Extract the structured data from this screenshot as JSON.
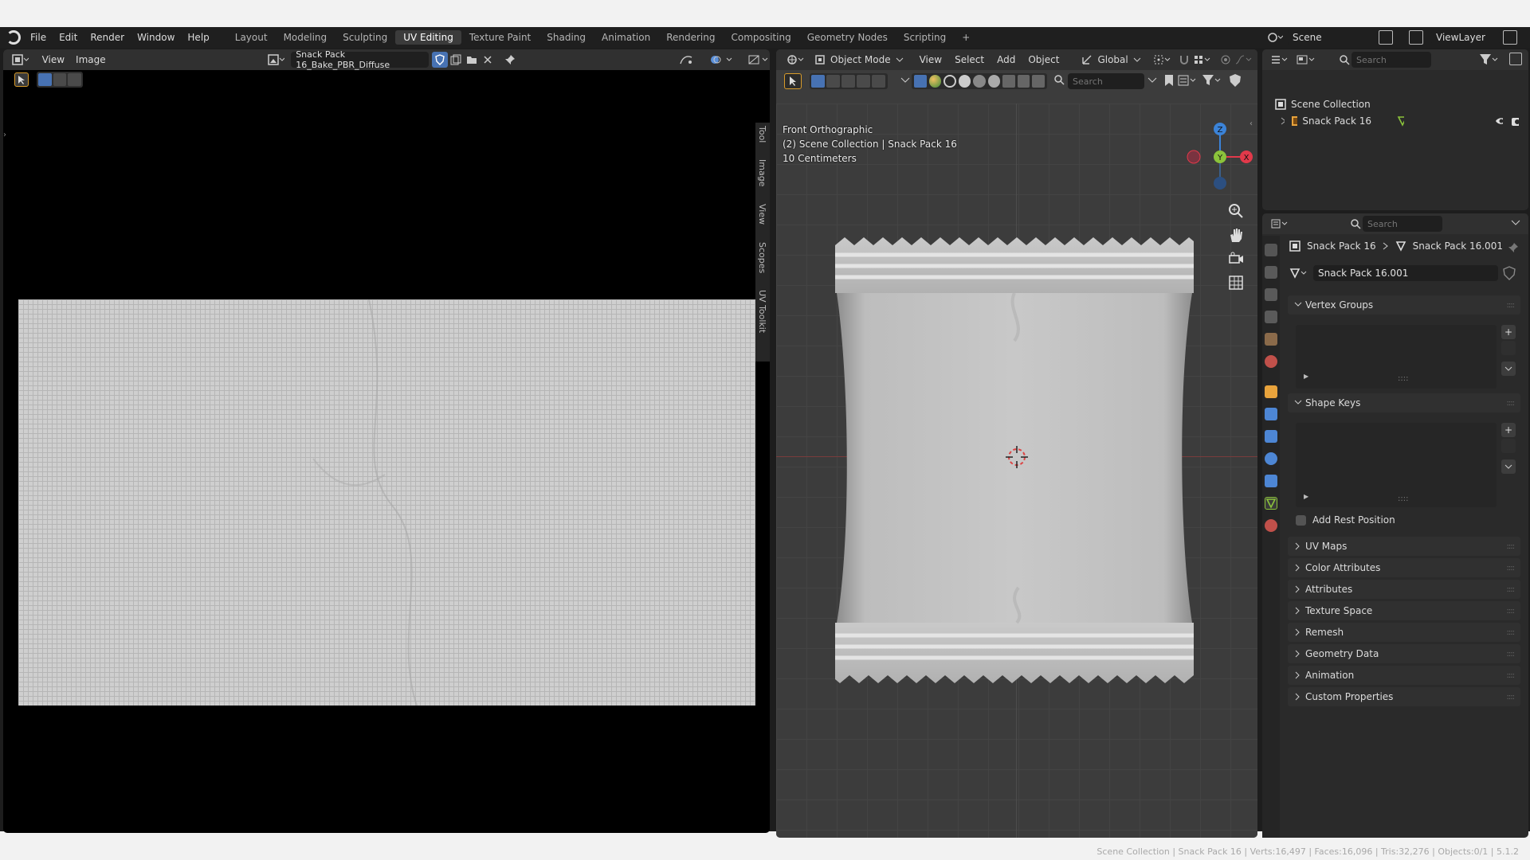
{
  "menu": [
    "File",
    "Edit",
    "Render",
    "Window",
    "Help"
  ],
  "workspaces": [
    "Layout",
    "Modeling",
    "Sculpting",
    "UV Editing",
    "Texture Paint",
    "Shading",
    "Animation",
    "Rendering",
    "Compositing",
    "Geometry Nodes",
    "Scripting"
  ],
  "active_workspace": "UV Editing",
  "add_workspace": "+",
  "scene": {
    "label": "Scene",
    "view_layer": "ViewLayer"
  },
  "uv_editor": {
    "menu": [
      "View",
      "Image"
    ],
    "image_name": "Snack Pack 16_Bake_PBR_Diffuse",
    "side_tabs": [
      "Tool",
      "Image",
      "View",
      "Scopes",
      "UV Toolkit"
    ]
  },
  "viewport": {
    "mode": "Object Mode",
    "menu": [
      "View",
      "Select",
      "Add",
      "Object"
    ],
    "orientation": "Global",
    "search_placeholder": "Search",
    "view_name": "Front Orthographic",
    "collection_info": "(2) Scene Collection | Snack Pack 16",
    "scale": "10 Centimeters",
    "gizmo": {
      "z": "Z",
      "y": "Y",
      "x": "X"
    }
  },
  "outliner": {
    "search_placeholder": "Search",
    "root": "Scene Collection",
    "items": [
      {
        "label": "Snack Pack 16"
      }
    ]
  },
  "properties": {
    "search_placeholder": "Search",
    "breadcrumb": [
      "Snack Pack 16",
      "Snack Pack 16.001"
    ],
    "datablock": "Snack Pack 16.001",
    "vertex_groups": "Vertex Groups",
    "shape_keys": "Shape Keys",
    "add_rest_position": "Add Rest Position",
    "panels": [
      "UV Maps",
      "Color Attributes",
      "Attributes",
      "Texture Space",
      "Remesh",
      "Geometry Data",
      "Animation",
      "Custom Properties"
    ]
  },
  "status_bar": "Scene Collection | Snack Pack 16 | Verts:16,497 | Faces:16,096 | Tris:32,276 | Objects:0/1 | 5.1.2",
  "colors": {
    "accent": "#4772b3",
    "axis_x": "#e2394a",
    "axis_y": "#8bc33b",
    "axis_z": "#3b83d8",
    "object_active": "#e8a33c"
  }
}
